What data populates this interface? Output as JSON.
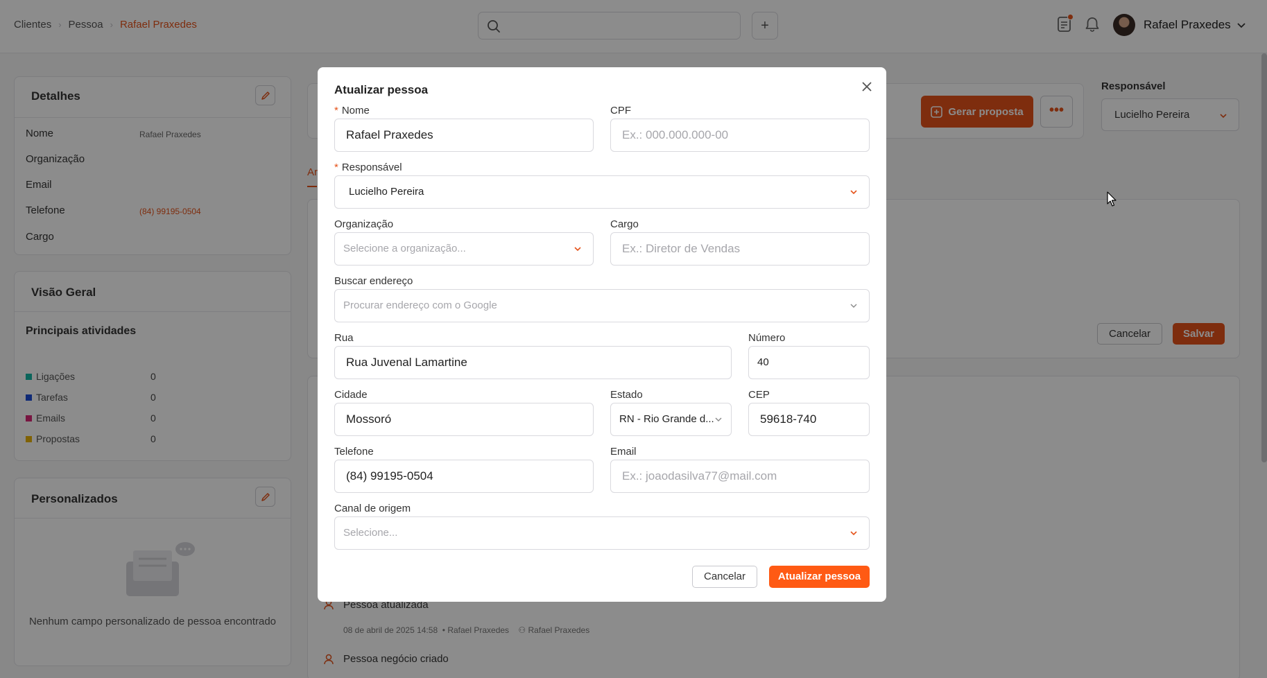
{
  "breadcrumb": [
    "Clientes",
    "Pessoa",
    "Rafael Praxedes"
  ],
  "header": {
    "user_name": "Rafael Praxedes",
    "add_label": "+"
  },
  "details": {
    "title": "Detalhes",
    "rows": [
      {
        "label": "Nome",
        "value": "Rafael Praxedes"
      },
      {
        "label": "Organização",
        "value": ""
      },
      {
        "label": "Email",
        "value": ""
      },
      {
        "label": "Telefone",
        "value": "(84) 99195-0504"
      },
      {
        "label": "Cargo",
        "value": ""
      }
    ]
  },
  "overview": {
    "title": "Visão Geral",
    "subtitle": "Principais atividades",
    "activities": [
      {
        "label": "Ligações",
        "count": "0",
        "color": "#14b8a6"
      },
      {
        "label": "Tarefas",
        "count": "0",
        "color": "#1d4ed8"
      },
      {
        "label": "Emails",
        "count": "0",
        "color": "#db2777"
      },
      {
        "label": "Propostas",
        "count": "0",
        "color": "#eab308"
      }
    ]
  },
  "custom": {
    "title": "Personalizados",
    "empty_text": "Nenhum campo personalizado de pessoa encontrado"
  },
  "actions": {
    "gerar_proposta": "Gerar proposta",
    "more": "•••",
    "responsavel_label": "Responsável",
    "responsavel_value": "Lucielho Pereira",
    "tab_fragment": "Ar",
    "note_cancel": "Cancelar",
    "note_save": "Salvar"
  },
  "timeline": {
    "item1_title": "Pessoa atualizada",
    "item1_date": "08 de abril de 2025 14:58",
    "item1_author": "• Rafael Praxedes",
    "item1_owner": "Rafael Praxedes",
    "item2_title": "Pessoa negócio criado"
  },
  "modal": {
    "title": "Atualizar pessoa",
    "fields": {
      "nome": {
        "label": "Nome",
        "value": "Rafael Praxedes"
      },
      "cpf": {
        "label": "CPF",
        "placeholder": "Ex.: 000.000.000-00"
      },
      "responsavel": {
        "label": "Responsável",
        "value": "Lucielho Pereira"
      },
      "organizacao": {
        "label": "Organização",
        "placeholder": "Selecione a organização..."
      },
      "cargo": {
        "label": "Cargo",
        "placeholder": "Ex.: Diretor de Vendas"
      },
      "endereco": {
        "label": "Buscar endereço",
        "placeholder": "Procurar endereço com o Google"
      },
      "rua": {
        "label": "Rua",
        "value": "Rua Juvenal Lamartine"
      },
      "numero": {
        "label": "Número",
        "value": "40"
      },
      "cidade": {
        "label": "Cidade",
        "value": "Mossoró"
      },
      "estado": {
        "label": "Estado",
        "value": "RN - Rio Grande d..."
      },
      "cep": {
        "label": "CEP",
        "value": "59618-740"
      },
      "telefone": {
        "label": "Telefone",
        "value": "(84) 99195-0504"
      },
      "email": {
        "label": "Email",
        "placeholder": "Ex.: joaodasilva77@mail.com"
      },
      "canal": {
        "label": "Canal de origem",
        "placeholder": "Selecione..."
      }
    },
    "cancel_label": "Cancelar",
    "submit_label": "Atualizar pessoa"
  },
  "colors": {
    "accent": "#e5531b",
    "accent_bright": "#ff5a14"
  }
}
